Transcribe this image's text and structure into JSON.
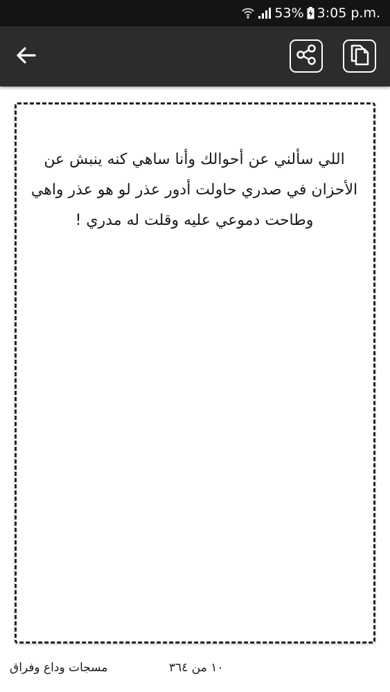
{
  "status_bar": {
    "battery_percent": "53%",
    "time": "3:05 p.m.",
    "icons": [
      "wifi-icon",
      "signal-icon",
      "battery-charging-icon"
    ]
  },
  "app_bar": {
    "back_icon": "arrow-left-icon",
    "share_icon": "share-icon",
    "copy_icon": "copy-icon"
  },
  "message": {
    "text": "اللي سألني عن أحوالك وأنا ساهي كنه ينبش عن الأحزان في صدري حاولت أدور عذر لو هو عذر واهي وطاحت دموعي عليه وقلت له مدري !"
  },
  "footer": {
    "counter": "١٠ من ٣٦٤",
    "category": "مسجات وداع وفراق"
  },
  "colors": {
    "status_bar_bg": "#141414",
    "app_bar_bg": "#2c2c2c",
    "card_border": "#222222",
    "text": "#1a1a1a"
  }
}
